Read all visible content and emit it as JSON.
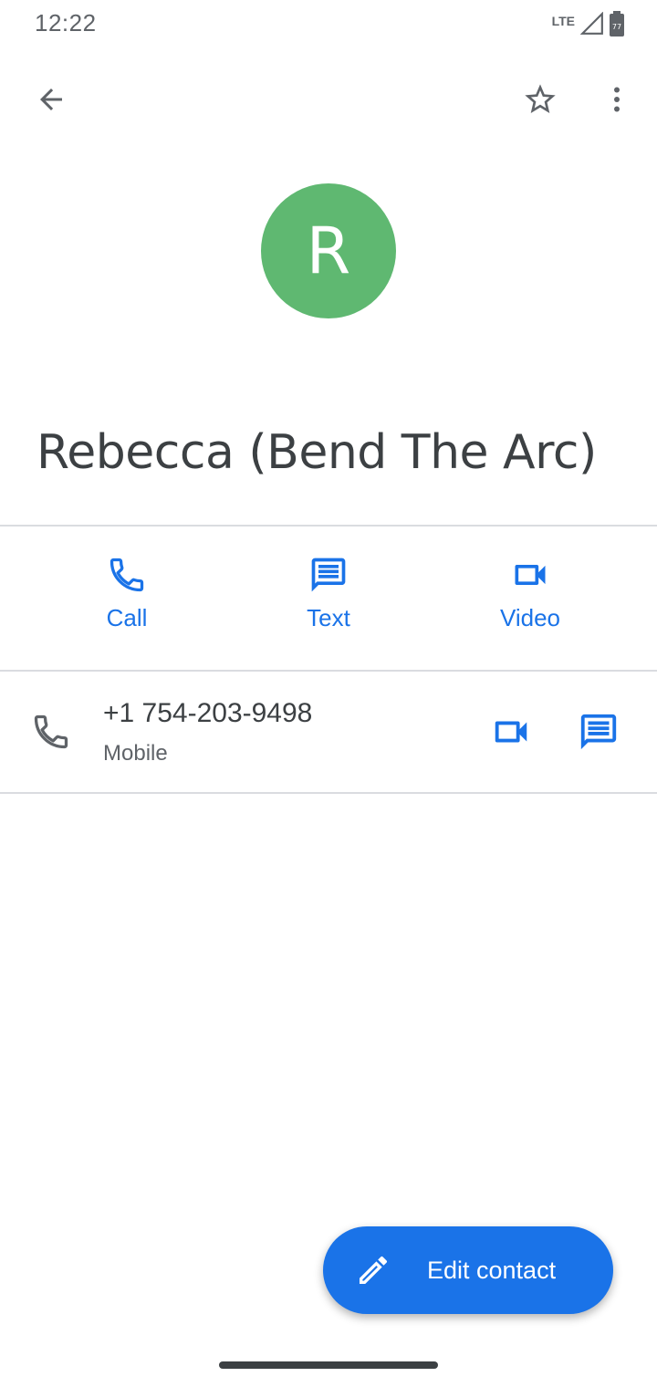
{
  "status_bar": {
    "time": "12:22",
    "network": "LTE",
    "battery": "77"
  },
  "toolbar": {
    "back_icon": "arrow-back-icon",
    "star_icon": "star-outline-icon",
    "more_icon": "more-vert-icon"
  },
  "contact": {
    "initial": "R",
    "name": "Rebecca (Bend The Arc)",
    "avatar_color": "#5fb871"
  },
  "actions": [
    {
      "label": "Call",
      "icon": "phone-icon"
    },
    {
      "label": "Text",
      "icon": "message-icon"
    },
    {
      "label": "Video",
      "icon": "videocam-icon"
    }
  ],
  "phone_entry": {
    "number": "+1 754-203-9498",
    "type": "Mobile"
  },
  "fab": {
    "label": "Edit contact",
    "icon": "pencil-icon"
  },
  "colors": {
    "accent": "#1a73e8",
    "icon_gray": "#5f6368",
    "divider": "#dadce0"
  }
}
